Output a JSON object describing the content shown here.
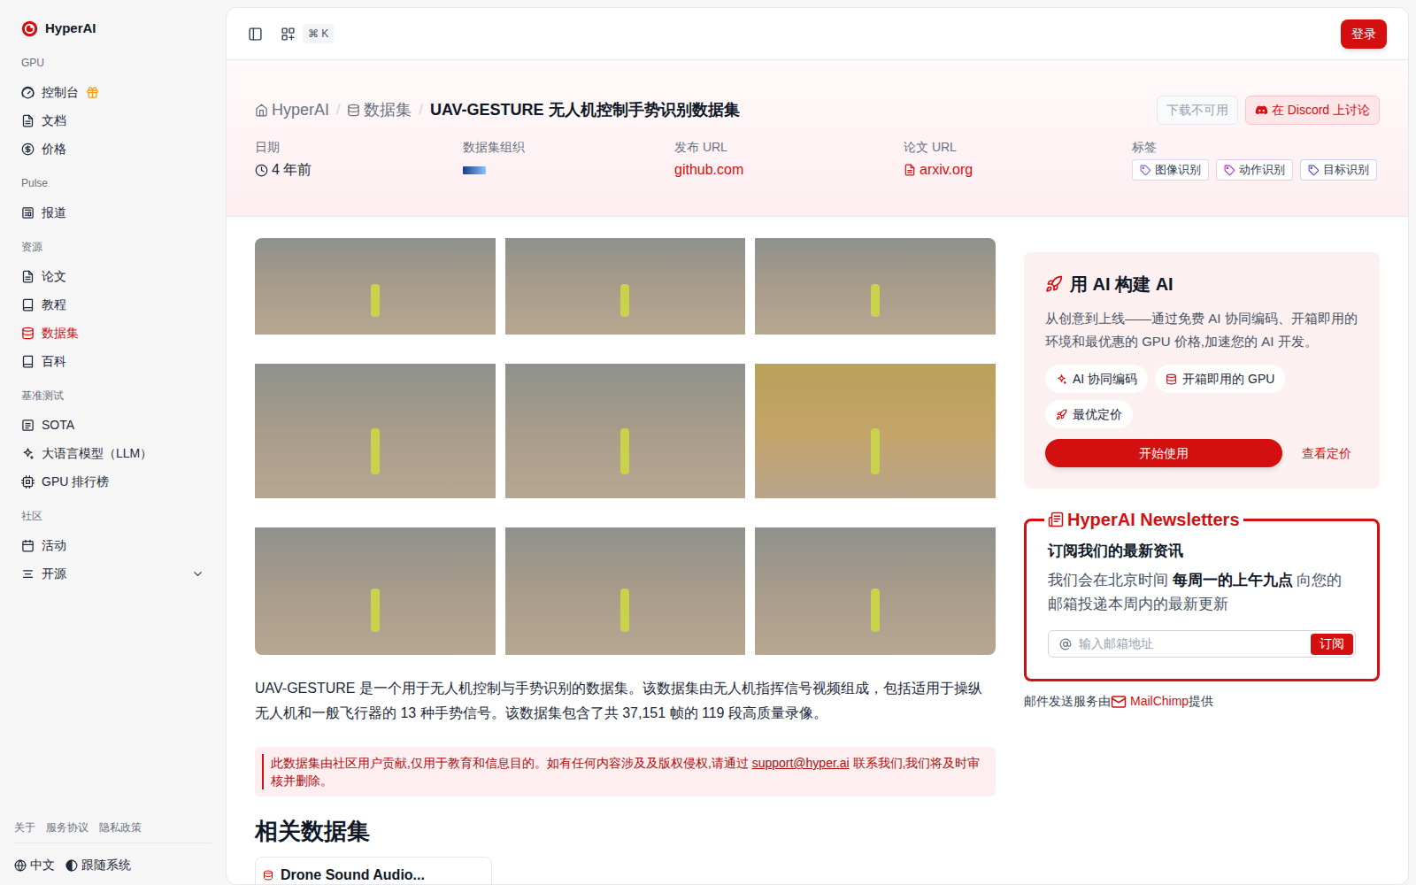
{
  "sidebar": {
    "logo": "HyperAI",
    "sections": [
      {
        "title": "GPU",
        "items": [
          {
            "label": "控制台",
            "selected": false
          },
          {
            "label": "文档",
            "selected": false
          },
          {
            "label": "价格",
            "selected": false
          }
        ]
      },
      {
        "title": "Pulse",
        "items": [
          {
            "label": "报道",
            "selected": false
          }
        ]
      },
      {
        "title": "资源",
        "items": [
          {
            "label": "论文",
            "selected": false
          },
          {
            "label": "教程",
            "selected": false
          },
          {
            "label": "数据集",
            "selected": true
          },
          {
            "label": "百科",
            "selected": false
          }
        ]
      },
      {
        "title": "基准测试",
        "items": [
          {
            "label": "SOTA",
            "selected": false
          },
          {
            "label": "大语言模型（LLM）",
            "selected": false
          },
          {
            "label": "GPU 排行榜",
            "selected": false
          }
        ]
      },
      {
        "title": "社区",
        "items": [
          {
            "label": "活动",
            "selected": false
          },
          {
            "label": "开源",
            "selected": false,
            "expanded": false
          }
        ]
      }
    ],
    "footer_links": [
      "关于",
      "服务协议",
      "隐私政策"
    ],
    "language": "中文",
    "theme": "跟随系统"
  },
  "topbar": {
    "shortcut": "⌘ K",
    "login": "登录"
  },
  "breadcrumb": {
    "items": [
      "HyperAI",
      "数据集",
      "UAV-GESTURE 无人机控制手势识别数据集"
    ],
    "separator": "/"
  },
  "actions": [
    {
      "label": "下载不可用",
      "disabled": true
    },
    {
      "label": "在 Discord 上讨论",
      "disabled": false
    }
  ],
  "meta": {
    "date": {
      "label": "日期",
      "value": "4 年前"
    },
    "organization": {
      "label": "数据集组织"
    },
    "release_url": {
      "label": "发布 URL",
      "value": "github.com"
    },
    "paper_url": {
      "label": "论文 URL",
      "value": "arxiv.org"
    },
    "tags": {
      "label": "标签",
      "items": [
        {
          "label": "图像识别",
          "color": "#8b5cf6"
        },
        {
          "label": "动作识别",
          "color": "#c026d3"
        },
        {
          "label": "目标识别",
          "color": "#4f46e5"
        }
      ]
    }
  },
  "description": "UAV-GESTURE 是一个用于无人机控制与手势识别的数据集。该数据集由无人机指挥信号视频组成，包括适用于操纵无人机和一般飞行器的 13 种手势信号。该数据集包含了共 37,151 帧的 119 段高质量录像。",
  "notice": {
    "before": "此数据集由社区用户贡献,仅用于教育和信息目的。如有任何内容涉及及版权侵权,请通过 ",
    "email": "support@hyper.ai",
    "after": " 联系我们,我们将及时审核并删除。"
  },
  "related": {
    "title": "相关数据集",
    "items": [
      "Drone Sound Audio..."
    ]
  },
  "promo": {
    "title": "用 AI 构建 AI",
    "text": "从创意到上线——通过免费 AI 协同编码、开箱即用的环境和最优惠的 GPU 价格,加速您的 AI 开发。",
    "features": [
      "AI 协同编码",
      "开箱即用的 GPU",
      "最优定价"
    ],
    "primary": "开始使用",
    "secondary": "查看定价"
  },
  "newsletter": {
    "legend": "HyperAI Newsletters",
    "title": "订阅我们的最新资讯",
    "text_before": "我们会在北京时间 ",
    "text_bold": "每周一的上午九点",
    "text_after": " 向您的邮箱投递本周内的最新更新",
    "placeholder": "输入邮箱地址",
    "button": "订阅"
  },
  "mail_service": {
    "before": "邮件发送服务由 ",
    "provider": "MailChimp",
    "after": " 提供"
  }
}
